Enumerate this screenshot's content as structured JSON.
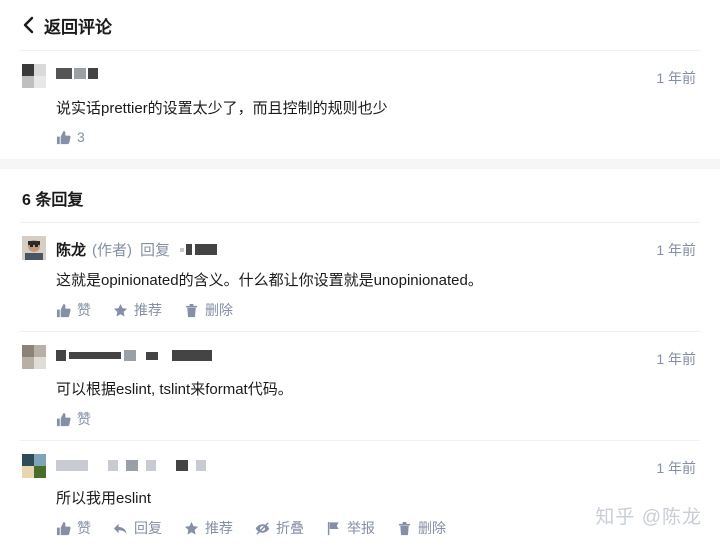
{
  "header": {
    "back_label": "返回评论"
  },
  "root_comment": {
    "time": "1 年前",
    "text": "说实话prettier的设置太少了，而且控制的规则也少",
    "likes": "3"
  },
  "replies_title": "6 条回复",
  "replies": [
    {
      "author": "陈龙",
      "author_tag": "(作者)",
      "reply_word": "回复",
      "time": "1 年前",
      "text": "这就是opinionated的含义。什么都让你设置就是unopinionated。",
      "actions": [
        "赞",
        "推荐",
        "删除"
      ]
    },
    {
      "time": "1 年前",
      "text": "可以根据eslint, tslint来format代码。",
      "actions": [
        "赞"
      ]
    },
    {
      "time": "1 年前",
      "text": "所以我用eslint",
      "actions": [
        "赞",
        "回复",
        "推荐",
        "折叠",
        "举报",
        "删除"
      ]
    }
  ],
  "watermark": "知乎 @陈龙",
  "colors": {
    "muted": "#8590a6",
    "text": "#1a1a1a",
    "divider": "#f0f0f2"
  }
}
